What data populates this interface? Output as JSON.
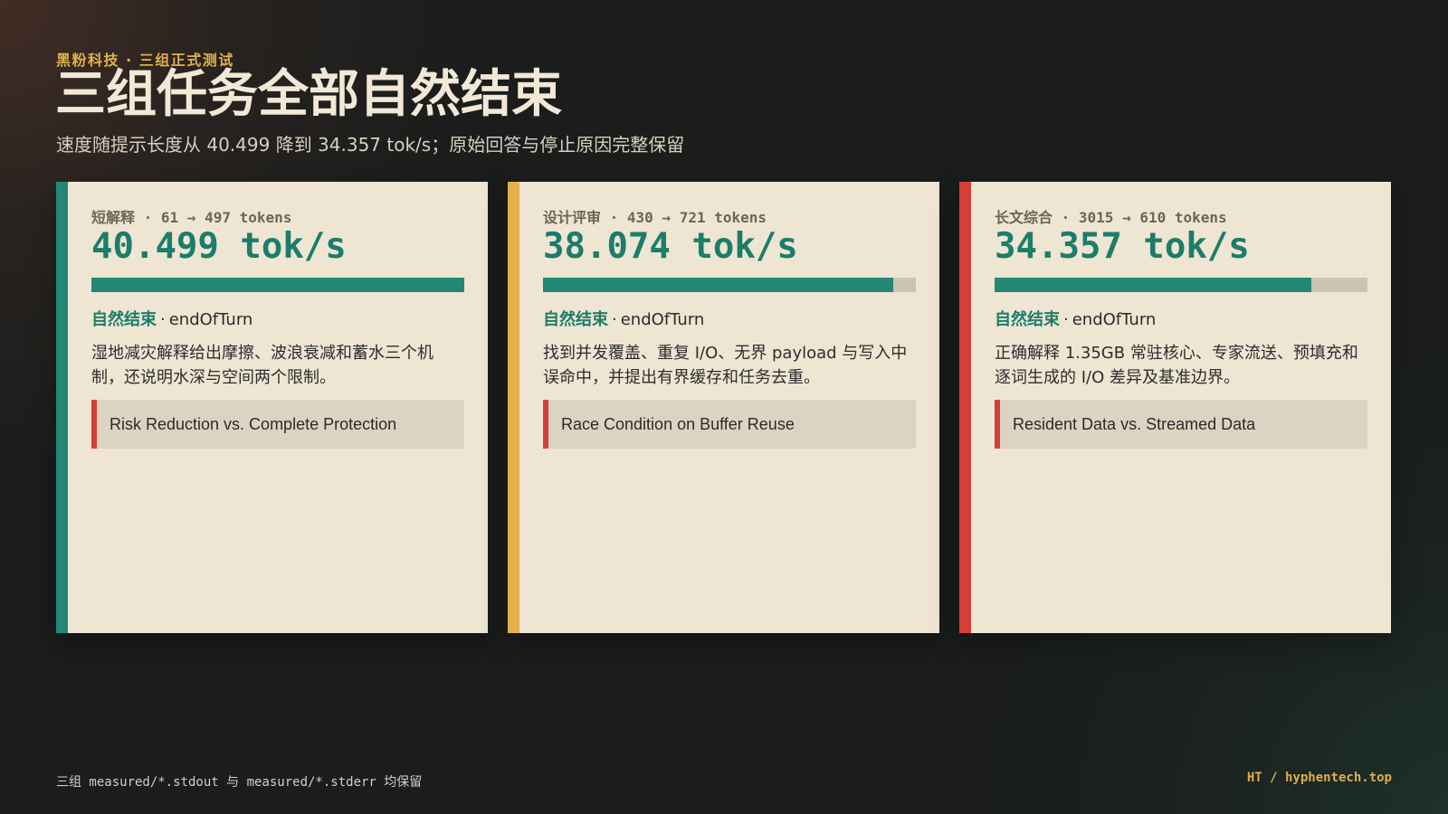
{
  "header": {
    "kicker": "黑粉科技 · 三组正式测试",
    "title": "三组任务全部自然结束",
    "subtitle": "速度随提示长度从 40.499 降到 34.357 tok/s；原始回答与停止原因完整保留"
  },
  "colors": {
    "teal": "#248776",
    "gold": "#e3b04b",
    "red": "#d24037",
    "card_bg": "#eee5d3"
  },
  "cards": [
    {
      "meta": "短解释 · 61 → 497 tokens",
      "metric": "40.499 tok/s",
      "progress_fraction": 1.0,
      "status_strong": "自然结束",
      "status_rest": "endOfTurn",
      "description": "湿地减灾解释给出摩擦、波浪衰减和蓄水三个机制，还说明水深与空间两个限制。",
      "tag": "Risk Reduction vs. Complete Protection",
      "accent_color": "#248776"
    },
    {
      "meta": "设计评审 · 430 → 721 tokens",
      "metric": "38.074 tok/s",
      "progress_fraction": 0.94,
      "status_strong": "自然结束",
      "status_rest": "endOfTurn",
      "description": "找到并发覆盖、重复 I/O、无界 payload 与写入中误命中，并提出有界缓存和任务去重。",
      "tag": "Race Condition on Buffer Reuse",
      "accent_color": "#e3b04b"
    },
    {
      "meta": "长文综合 · 3015 → 610 tokens",
      "metric": "34.357 tok/s",
      "progress_fraction": 0.85,
      "status_strong": "自然结束",
      "status_rest": "endOfTurn",
      "description": "正确解释 1.35GB 常驻核心、专家流送、预填充和逐词生成的 I/O 差异及基准边界。",
      "tag": "Resident Data vs. Streamed Data",
      "accent_color": "#d24037"
    }
  ],
  "footer": {
    "left": "三组 measured/*.stdout 与 measured/*.stderr 均保留",
    "right": "HT / hyphentech.top"
  }
}
